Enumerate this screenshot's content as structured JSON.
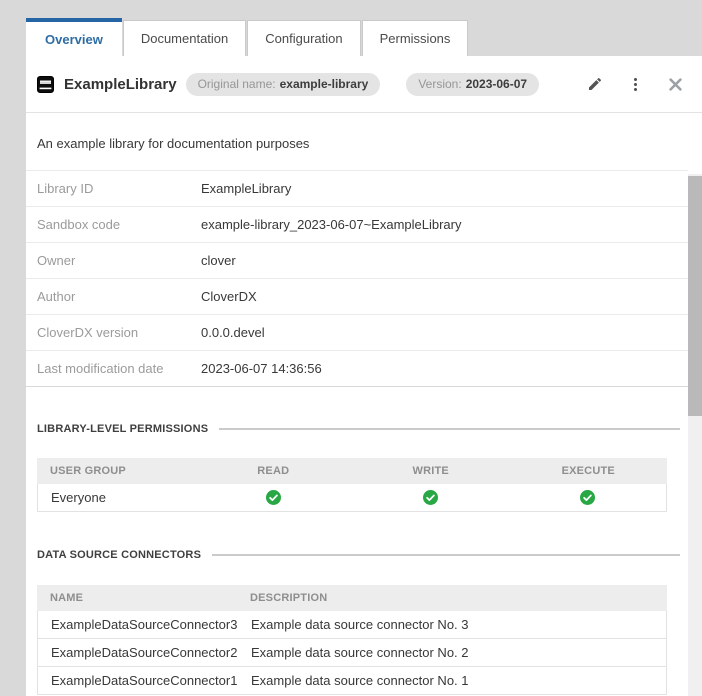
{
  "tabs": [
    {
      "label": "Overview",
      "active": true
    },
    {
      "label": "Documentation",
      "active": false
    },
    {
      "label": "Configuration",
      "active": false
    },
    {
      "label": "Permissions",
      "active": false
    }
  ],
  "header": {
    "title": "ExampleLibrary",
    "badges": [
      {
        "label": "Original name:",
        "value": "example-library"
      },
      {
        "label": "Version:",
        "value": "2023-06-07"
      }
    ],
    "actions": [
      {
        "icon": "pencil-edit-icon"
      },
      {
        "icon": "kebab-menu-icon"
      },
      {
        "icon": "close-icon"
      }
    ]
  },
  "overview": {
    "description": "An example library for documentation purposes",
    "details": [
      {
        "label": "Library ID",
        "value": "ExampleLibrary"
      },
      {
        "label": "Sandbox code",
        "value": "example-library_2023-06-07~ExampleLibrary"
      },
      {
        "label": "Owner",
        "value": "clover"
      },
      {
        "label": "Author",
        "value": "CloverDX"
      },
      {
        "label": "CloverDX version",
        "value": "0.0.0.devel"
      },
      {
        "label": "Last modification date",
        "value": "2023-06-07 14:36:56"
      }
    ]
  },
  "permissions_section": {
    "title": "LIBRARY-LEVEL PERMISSIONS",
    "columns": {
      "user_group": "USER GROUP",
      "read": "READ",
      "write": "WRITE",
      "execute": "EXECUTE"
    },
    "rows": [
      {
        "user_group": "Everyone",
        "read": "granted",
        "write": "granted",
        "execute": "granted"
      }
    ]
  },
  "connectors_section": {
    "title": "DATA SOURCE CONNECTORS",
    "columns": {
      "name": "NAME",
      "description": "DESCRIPTION"
    },
    "rows": [
      {
        "name": "ExampleDataSourceConnector3",
        "description": "Example data source connector No. 3"
      },
      {
        "name": "ExampleDataSourceConnector2",
        "description": "Example data source connector No. 2"
      },
      {
        "name": "ExampleDataSourceConnector1",
        "description": "Example data source connector No. 1"
      }
    ]
  },
  "colors": {
    "accent_blue": "#2565a5",
    "granted_green": "#28a745",
    "badge_bg": "#e4e4e4"
  }
}
